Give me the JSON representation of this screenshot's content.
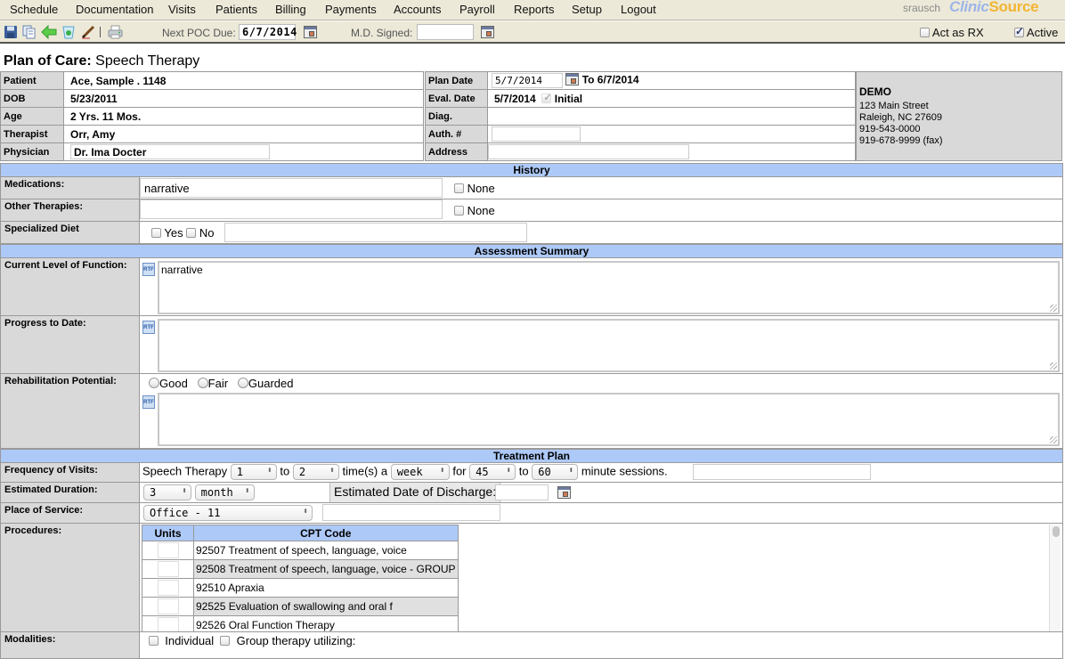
{
  "nav": {
    "items": [
      "Schedule",
      "Documentation",
      "Visits",
      "Patients",
      "Billing",
      "Payments",
      "Accounts",
      "Payroll",
      "Reports",
      "Setup",
      "Logout"
    ],
    "username": "srausch",
    "logo_part1": "Clinic",
    "logo_part2": "Source"
  },
  "toolbar": {
    "icons": [
      "save-icon",
      "copy-icon",
      "back-arrow-icon",
      "recycle-icon",
      "sign-pen-icon",
      "print-icon"
    ],
    "next_poc_label": "Next POC Due:",
    "next_poc_value": "6/7/2014",
    "md_signed_label": "M.D. Signed:",
    "md_signed_value": "",
    "act_as_rx_label": "Act as RX",
    "act_as_rx_checked": false,
    "active_label": "Active",
    "active_checked": true
  },
  "title": {
    "prefix": "Plan of Care:",
    "name": "Speech Therapy"
  },
  "patient_info": {
    "patient_label": "Patient",
    "patient_value": "Ace, Sample .  1148",
    "dob_label": "DOB",
    "dob_value": "5/23/2011",
    "age_label": "Age",
    "age_value": "2 Yrs. 11 Mos.",
    "therapist_label": "Therapist",
    "therapist_value": "Orr, Amy",
    "physician_label": "Physician",
    "physician_value": "Dr. Ima Docter"
  },
  "plan_info": {
    "plan_date_label": "Plan Date",
    "plan_date_value": "5/7/2014",
    "plan_date_to": "To 6/7/2014",
    "eval_date_label": "Eval. Date",
    "eval_date_value": "5/7/2014",
    "initial_label": "Initial",
    "diag_label": "Diag.",
    "diag_value": "",
    "auth_label": "Auth. #",
    "auth_value": "",
    "address_label": "Address",
    "address_value": ""
  },
  "clinic": {
    "name": "DEMO",
    "street": "123 Main Street",
    "city": "Raleigh, NC 27609",
    "phone": "919-543-0000",
    "fax": "919-678-9999 (fax)"
  },
  "history": {
    "header": "History",
    "medications_label": "Medications:",
    "medications_value": "narrative",
    "medications_none": "None",
    "other_therapies_label": "Other Therapies:",
    "other_therapies_value": "",
    "other_therapies_none": "None",
    "diet_label": "Specialized Diet",
    "diet_yes": "Yes",
    "diet_no": "No",
    "diet_value": ""
  },
  "assessment": {
    "header": "Assessment Summary",
    "current_label": "Current Level of Function:",
    "current_value": "narrative",
    "progress_label": "Progress to Date:",
    "progress_value": "",
    "rehab_label": "Rehabilitation Potential:",
    "rehab_options": [
      "Good",
      "Fair",
      "Guarded"
    ],
    "rehab_value": "",
    "rtf_icon": "RTF"
  },
  "treatment": {
    "header": "Treatment Plan",
    "frequency_label": "Frequency of Visits:",
    "freq_prefix": "Speech Therapy",
    "freq_min": "1",
    "to1": "to",
    "freq_max": "2",
    "times_a": "time(s) a",
    "period": "week",
    "for_label": "for",
    "min_minutes": "45",
    "to2": "to",
    "max_minutes": "60",
    "minute_sessions": "minute sessions.",
    "freq_note": "",
    "duration_label": "Estimated Duration:",
    "duration_value": "3",
    "duration_unit": "month",
    "discharge_label": "Estimated Date of Discharge:",
    "discharge_value": "",
    "place_label": "Place of Service:",
    "place_value": "Office - 11",
    "place_note": "",
    "procedures_label": "Procedures:",
    "procedures_units_header": "Units",
    "procedures_cpt_header": "CPT Code",
    "procedures": [
      {
        "units": "",
        "code": "92507 Treatment of speech, language, voice"
      },
      {
        "units": "",
        "code": "92508 Treatment of speech, language, voice - GROUP"
      },
      {
        "units": "",
        "code": "92510 Apraxia"
      },
      {
        "units": "",
        "code": "92525 Evaluation of swallowing and oral f"
      },
      {
        "units": "",
        "code": "92526 Oral Function Therapy"
      }
    ],
    "modalities_label": "Modalities:",
    "modality_individual": "Individual",
    "modality_group": "Group therapy utilizing:"
  }
}
